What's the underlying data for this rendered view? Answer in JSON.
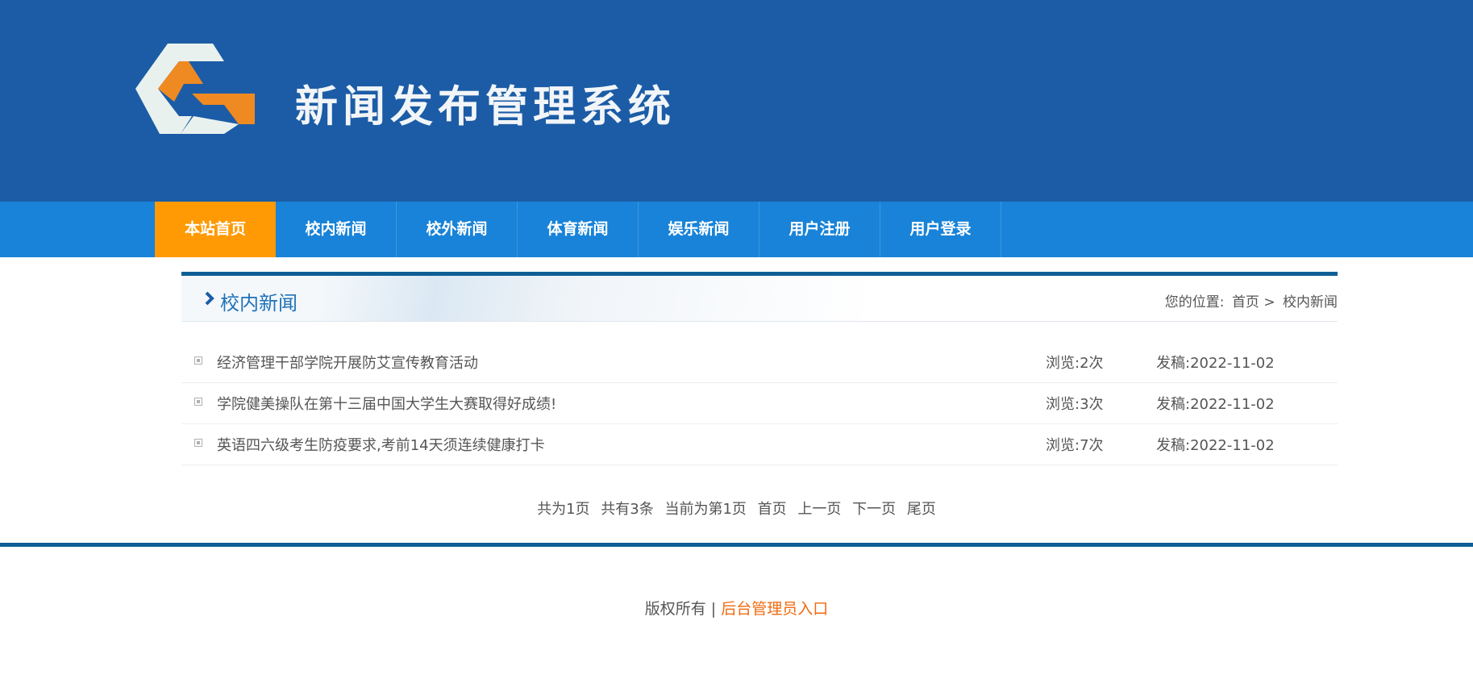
{
  "header": {
    "site_title": "新闻发布管理系统"
  },
  "nav": {
    "items": [
      {
        "label": "本站首页",
        "active": true
      },
      {
        "label": "校内新闻",
        "active": false
      },
      {
        "label": "校外新闻",
        "active": false
      },
      {
        "label": "体育新闻",
        "active": false
      },
      {
        "label": "娱乐新闻",
        "active": false
      },
      {
        "label": "用户注册",
        "active": false
      },
      {
        "label": "用户登录",
        "active": false
      }
    ]
  },
  "section": {
    "title": "校内新闻",
    "breadcrumb": {
      "prefix": "您的位置:",
      "home": "首页 >",
      "current": "校内新闻"
    }
  },
  "news": [
    {
      "title": "经济管理干部学院开展防艾宣传教育活动",
      "views": "浏览:2次",
      "date": "发稿:2022-11-02"
    },
    {
      "title": "学院健美操队在第十三届中国大学生大赛取得好成绩!",
      "views": "浏览:3次",
      "date": "发稿:2022-11-02"
    },
    {
      "title": "英语四六级考生防疫要求,考前14天须连续健康打卡",
      "views": "浏览:7次",
      "date": "发稿:2022-11-02"
    }
  ],
  "pager": {
    "total_pages": "共为1页",
    "total_items": "共有3条",
    "current": "当前为第1页",
    "first": "首页",
    "prev": "上一页",
    "next": "下一页",
    "last": "尾页"
  },
  "footer": {
    "copyright": "版权所有 |",
    "admin_link": "后台管理员入口"
  },
  "colors": {
    "header_bg": "#1c5ca6",
    "nav_bg": "#1883d8",
    "nav_active": "#ff9a04",
    "accent_link": "#f06a0f",
    "section_title": "#1f72b8"
  }
}
